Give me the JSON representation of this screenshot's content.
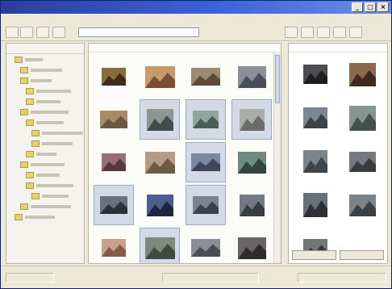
{
  "window": {
    "title": ""
  },
  "menu": [
    "",
    "",
    "",
    ""
  ],
  "toolbar": {
    "address": ""
  },
  "tree": {
    "header": "",
    "nodes": [
      {
        "depth": 1,
        "label": ""
      },
      {
        "depth": 2,
        "label": ""
      },
      {
        "depth": 2,
        "label": ""
      },
      {
        "depth": 3,
        "label": ""
      },
      {
        "depth": 3,
        "label": ""
      },
      {
        "depth": 2,
        "label": ""
      },
      {
        "depth": 3,
        "label": ""
      },
      {
        "depth": 4,
        "label": ""
      },
      {
        "depth": 4,
        "label": ""
      },
      {
        "depth": 3,
        "label": ""
      },
      {
        "depth": 2,
        "label": ""
      },
      {
        "depth": 3,
        "label": ""
      },
      {
        "depth": 3,
        "label": ""
      },
      {
        "depth": 4,
        "label": ""
      },
      {
        "depth": 2,
        "label": ""
      },
      {
        "depth": 1,
        "label": ""
      }
    ]
  },
  "gallery": {
    "header": "",
    "thumbnails": [
      {
        "label": "",
        "colors": [
          "#3f2a1c",
          "#8b6a3e"
        ],
        "selected": false
      },
      {
        "label": "",
        "colors": [
          "#7a5136",
          "#c89a6a"
        ],
        "selected": false
      },
      {
        "label": "",
        "colors": [
          "#5b4a3a",
          "#9a8b74"
        ],
        "selected": false
      },
      {
        "label": "",
        "colors": [
          "#4b4e58",
          "#8a8f99"
        ],
        "selected": false
      },
      {
        "label": "",
        "colors": [
          "#6e5642",
          "#a88a6a"
        ],
        "selected": false
      },
      {
        "label": "",
        "colors": [
          "#454a4a",
          "#8c9792"
        ],
        "selected": true
      },
      {
        "label": "",
        "colors": [
          "#4a5d57",
          "#8fa69c"
        ],
        "selected": true
      },
      {
        "label": "",
        "colors": [
          "#6a6a66",
          "#a8ada8"
        ],
        "selected": true
      },
      {
        "label": "",
        "colors": [
          "#553842",
          "#9a6e78"
        ],
        "selected": false
      },
      {
        "label": "",
        "colors": [
          "#6b5a46",
          "#b59c80"
        ],
        "selected": false
      },
      {
        "label": "",
        "colors": [
          "#3e4658",
          "#7b86a0"
        ],
        "selected": true
      },
      {
        "label": "",
        "colors": [
          "#34443e",
          "#6f8a80"
        ],
        "selected": false
      },
      {
        "label": "",
        "colors": [
          "#2c3038",
          "#6a7080"
        ],
        "selected": true
      },
      {
        "label": "",
        "colors": [
          "#1e2540",
          "#4e5c8c"
        ],
        "selected": false
      },
      {
        "label": "",
        "colors": [
          "#3c4048",
          "#7c828e"
        ],
        "selected": true
      },
      {
        "label": "",
        "colors": [
          "#3a3d40",
          "#737a82"
        ],
        "selected": false
      },
      {
        "label": "",
        "colors": [
          "#8a5a48",
          "#caa08a"
        ],
        "selected": false
      },
      {
        "label": "",
        "colors": [
          "#3f4a40",
          "#7d8a7c"
        ],
        "selected": true
      },
      {
        "label": "",
        "colors": [
          "#4a4d52",
          "#8a8e95"
        ],
        "selected": false
      },
      {
        "label": "",
        "colors": [
          "#2e2c2e",
          "#6a6466"
        ],
        "selected": false
      }
    ]
  },
  "lightbox": {
    "header": "",
    "thumbnails": [
      {
        "colors": [
          "#1e1e20",
          "#4e4c50"
        ]
      },
      {
        "colors": [
          "#3a2a20",
          "#8a6a4a"
        ]
      },
      {
        "colors": [
          "#3c4246",
          "#7c8690"
        ]
      },
      {
        "colors": [
          "#44504c",
          "#86968e"
        ]
      },
      {
        "colors": [
          "#3e4448",
          "#7c848a"
        ]
      },
      {
        "colors": [
          "#3a3c3e",
          "#767a80"
        ]
      },
      {
        "colors": [
          "#2e3034",
          "#6a7078"
        ]
      },
      {
        "colors": [
          "#3a4044",
          "#7a828a"
        ]
      },
      {
        "colors": [
          "#34383a",
          "#70767a"
        ]
      }
    ],
    "buttons": [
      "",
      ""
    ]
  },
  "status": {
    "left": "",
    "middle": "",
    "right": ""
  }
}
